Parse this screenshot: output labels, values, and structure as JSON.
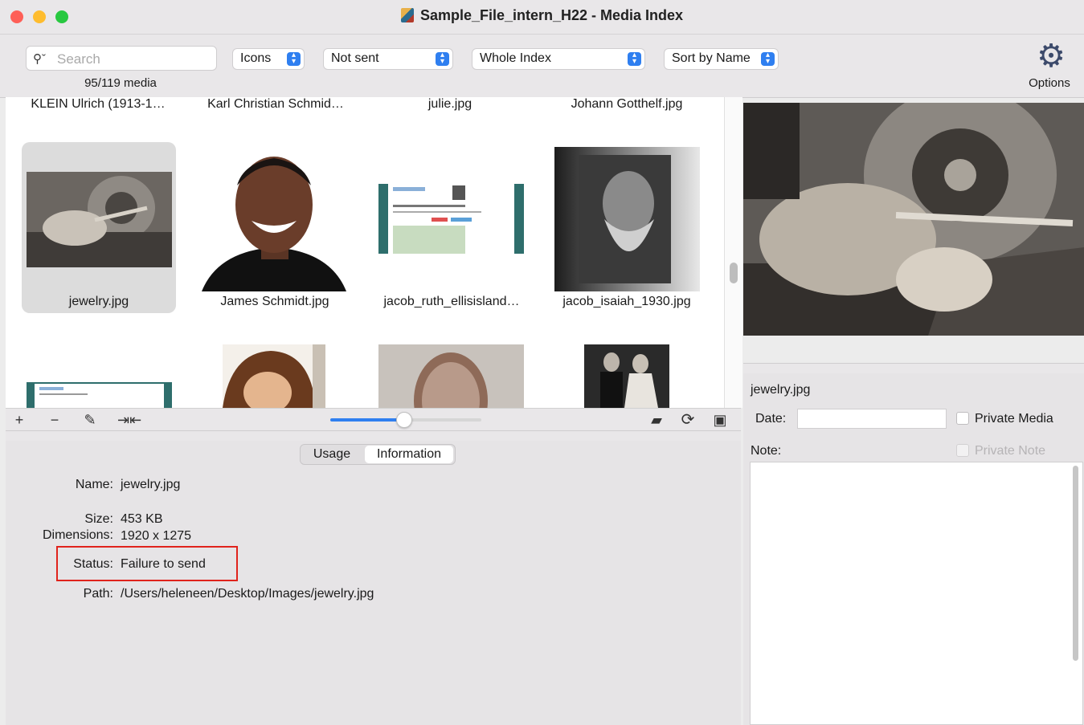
{
  "window": {
    "title": "Sample_File_intern_H22 - Media Index",
    "traffic_lights": {
      "close": "#fe5f57",
      "minimize": "#febc2e",
      "zoom": "#28c840"
    }
  },
  "toolbar": {
    "search_placeholder": "Search",
    "media_count": "95/119 media",
    "view_popup": "Icons",
    "send_popup": "Not sent",
    "scope_popup": "Whole Index",
    "sort_popup": "Sort by Name",
    "options_label": "Options",
    "accent": "#2f7ff0"
  },
  "grid": {
    "top_row": [
      "KLEIN Ulrich (1913-1…",
      "Karl Christian Schmid…",
      "julie.jpg",
      "Johann Gotthelf.jpg"
    ],
    "middle_row": [
      "jewelry.jpg",
      "James Schmidt.jpg",
      "jacob_ruth_ellisisland…",
      "jacob_isaiah_1930.jpg"
    ],
    "selected": "jewelry.jpg"
  },
  "bottom_toolbar": {
    "add_icon": "plus-icon",
    "remove_icon": "minus-icon",
    "edit_icon": "pencil-icon",
    "merge_icon": "merge-arrows-icon",
    "folder_icon": "folder-icon",
    "refresh_icon": "refresh-icon",
    "save_icon": "disk-icon",
    "zoom_level": 0.48
  },
  "info": {
    "tabs": [
      "Usage",
      "Information"
    ],
    "active_tab": "Information",
    "fields": {
      "name_label": "Name:",
      "name": "jewelry.jpg",
      "size_label": "Size:",
      "size": "453 KB",
      "dimensions_label": "Dimensions:",
      "dimensions": "1920 x 1275",
      "status_label": "Status:",
      "status": "Failure to send",
      "path_label": "Path:",
      "path": "/Users/heleneen/Desktop/Images/jewelry.jpg"
    },
    "highlight_color": "#e0231c"
  },
  "detail": {
    "filename": "jewelry.jpg",
    "date_label": "Date:",
    "date_value": "",
    "private_media_label": "Private Media",
    "note_label": "Note:",
    "private_note_label": "Private Note"
  }
}
